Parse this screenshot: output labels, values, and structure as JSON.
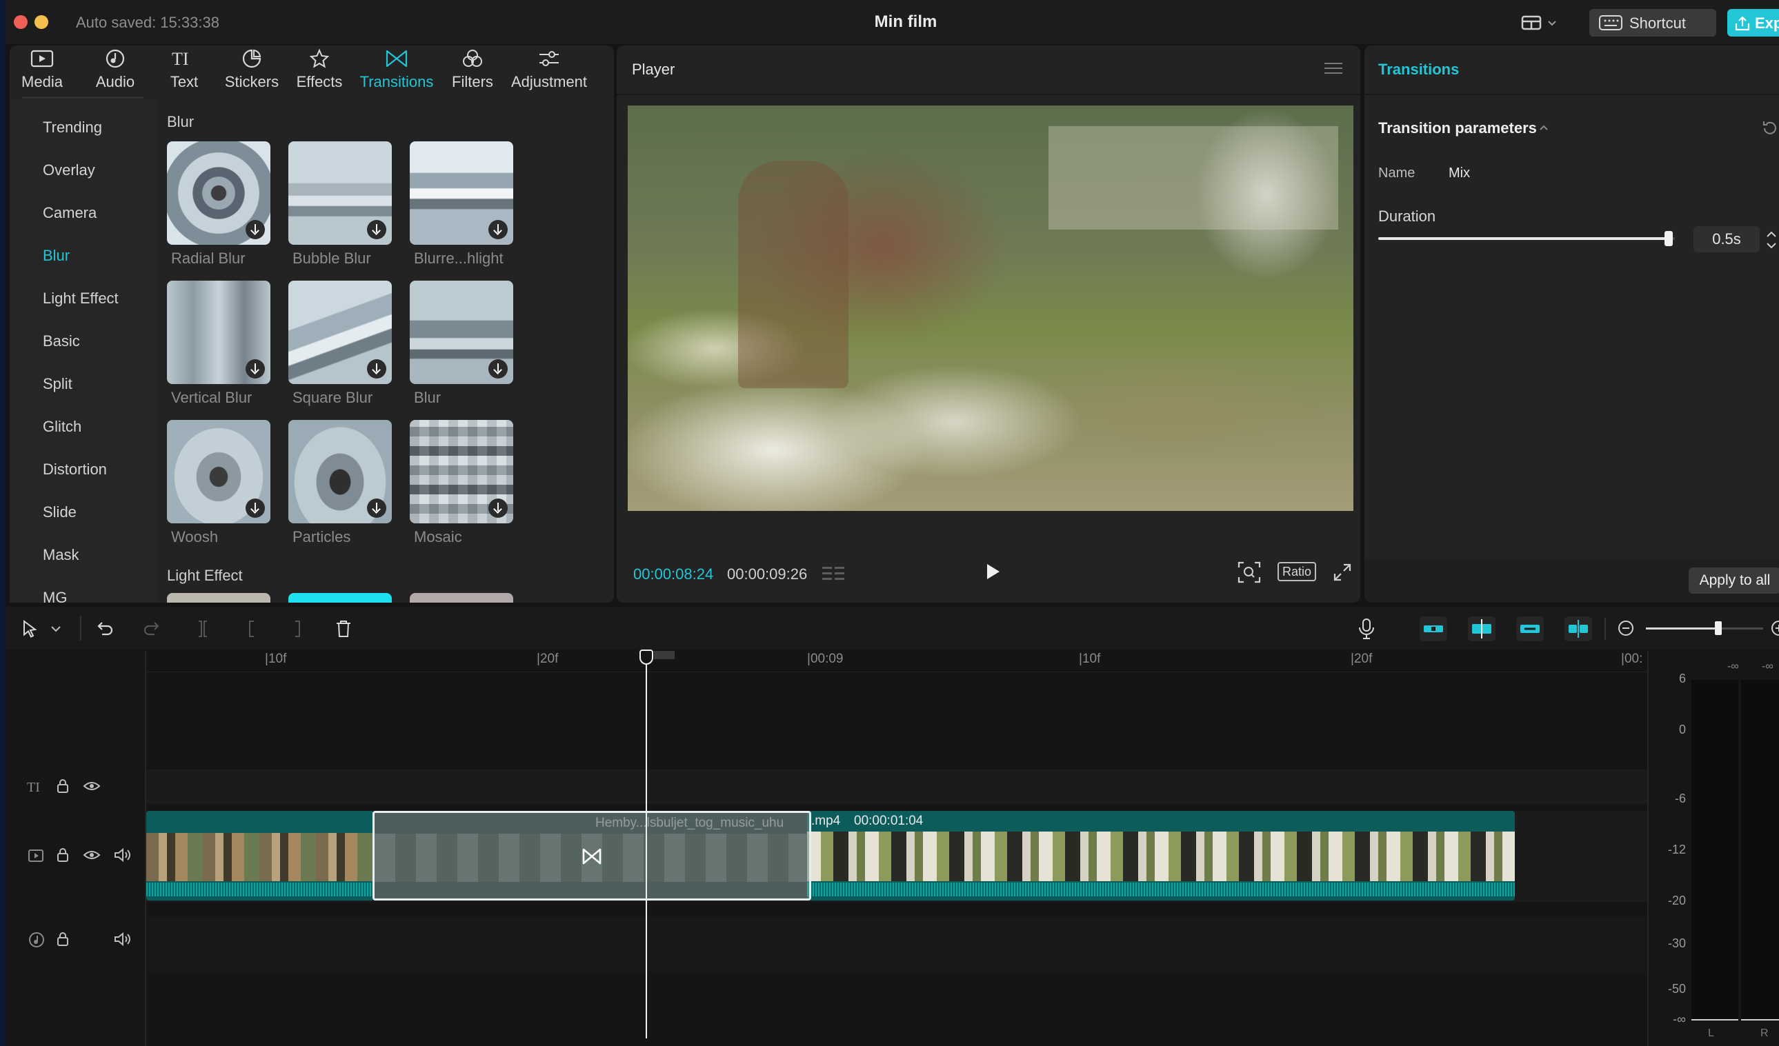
{
  "titlebar": {
    "autosave": "Auto saved: 15:33:38",
    "project_title": "Min film",
    "shortcut_label": "Shortcut",
    "export_label": "Export"
  },
  "media_tabs": [
    {
      "label": "Media",
      "icon": "media-icon"
    },
    {
      "label": "Audio",
      "icon": "audio-icon"
    },
    {
      "label": "Text",
      "icon": "text-icon"
    },
    {
      "label": "Stickers",
      "icon": "stickers-icon"
    },
    {
      "label": "Effects",
      "icon": "effects-icon"
    },
    {
      "label": "Transitions",
      "icon": "transitions-icon",
      "active": true
    },
    {
      "label": "Filters",
      "icon": "filters-icon"
    },
    {
      "label": "Adjustment",
      "icon": "adjustment-icon"
    }
  ],
  "categories": [
    "Trending",
    "Overlay",
    "Camera",
    "Blur",
    "Light Effect",
    "Basic",
    "Split",
    "Glitch",
    "Distortion",
    "Slide",
    "Mask",
    "MG"
  ],
  "active_category": "Blur",
  "section_blur": "Blur",
  "section_light": "Light Effect",
  "transitions": [
    {
      "label": "Radial Blur"
    },
    {
      "label": "Bubble Blur"
    },
    {
      "label": "Blurre...hlight"
    },
    {
      "label": "Vertical Blur"
    },
    {
      "label": "Square Blur"
    },
    {
      "label": "Blur"
    },
    {
      "label": "Woosh"
    },
    {
      "label": "Particles"
    },
    {
      "label": "Mosaic"
    }
  ],
  "player": {
    "title": "Player",
    "current_time": "00:00:08:24",
    "total_time": "00:00:09:26",
    "ratio_label": "Ratio"
  },
  "inspector": {
    "tab": "Transitions",
    "section": "Transition parameters",
    "name_label": "Name",
    "name_value": "Mix",
    "duration_label": "Duration",
    "duration_value": "0.5s",
    "duration_fraction": 0.98,
    "apply_all_label": "Apply to all"
  },
  "timeline": {
    "ruler": [
      "10f",
      "20f",
      "00:09",
      "10f",
      "20f",
      "00:"
    ],
    "clip_name": "Hemby...lsbuljet_tog_music_uhu",
    "clip_ext": ".mp4",
    "clip_duration": "00:00:01:04",
    "zoom_fraction": 0.62
  },
  "meter": {
    "scale": [
      "6",
      "0",
      "-6",
      "-12",
      "-20",
      "-30",
      "-50",
      "-∞"
    ],
    "top_left": "-∞",
    "top_right": "-∞",
    "left": "L",
    "right": "R"
  },
  "colors": {
    "accent": "#22c6d6",
    "panel": "#232323",
    "background": "#141414"
  }
}
